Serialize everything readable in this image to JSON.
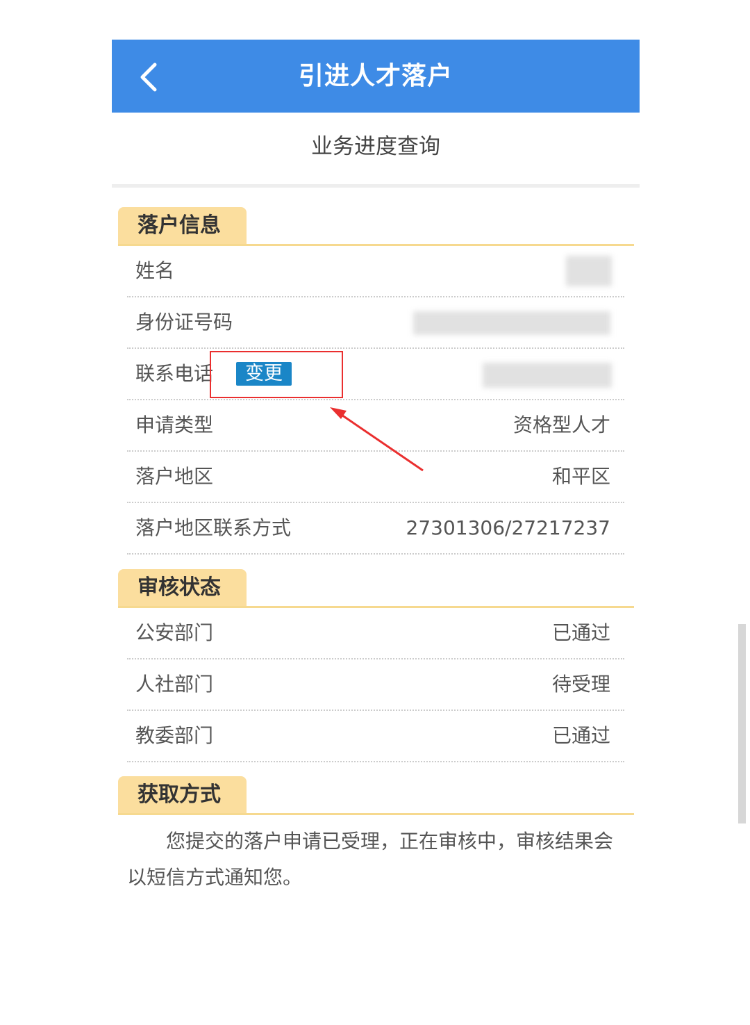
{
  "header": {
    "title": "引进人才落户",
    "back_icon": "chevron-left-icon",
    "color": "#3e8be6"
  },
  "subtitle": "业务进度查询",
  "sections": {
    "settle_info": {
      "title": "落户信息",
      "rows": [
        {
          "label": "姓名",
          "value": ""
        },
        {
          "label": "身份证号码",
          "value": ""
        },
        {
          "label": "联系电话",
          "value": "",
          "action_label": "变更"
        },
        {
          "label": "申请类型",
          "value": "资格型人才"
        },
        {
          "label": "落户地区",
          "value": "和平区"
        },
        {
          "label": "落户地区联系方式",
          "value": "27301306/27217237"
        }
      ]
    },
    "review_status": {
      "title": "审核状态",
      "rows": [
        {
          "label": "公安部门",
          "value": "已通过"
        },
        {
          "label": "人社部门",
          "value": "待受理"
        },
        {
          "label": "教委部门",
          "value": "已通过"
        }
      ]
    },
    "acquire": {
      "title": "获取方式",
      "text": "您提交的落户申请已受理，正在审核中，审核结果会以短信方式通知您。"
    }
  },
  "colors": {
    "section_tab": "#fbde9e",
    "change_button": "#1a86c7",
    "annotation": "#ea2f2f"
  }
}
